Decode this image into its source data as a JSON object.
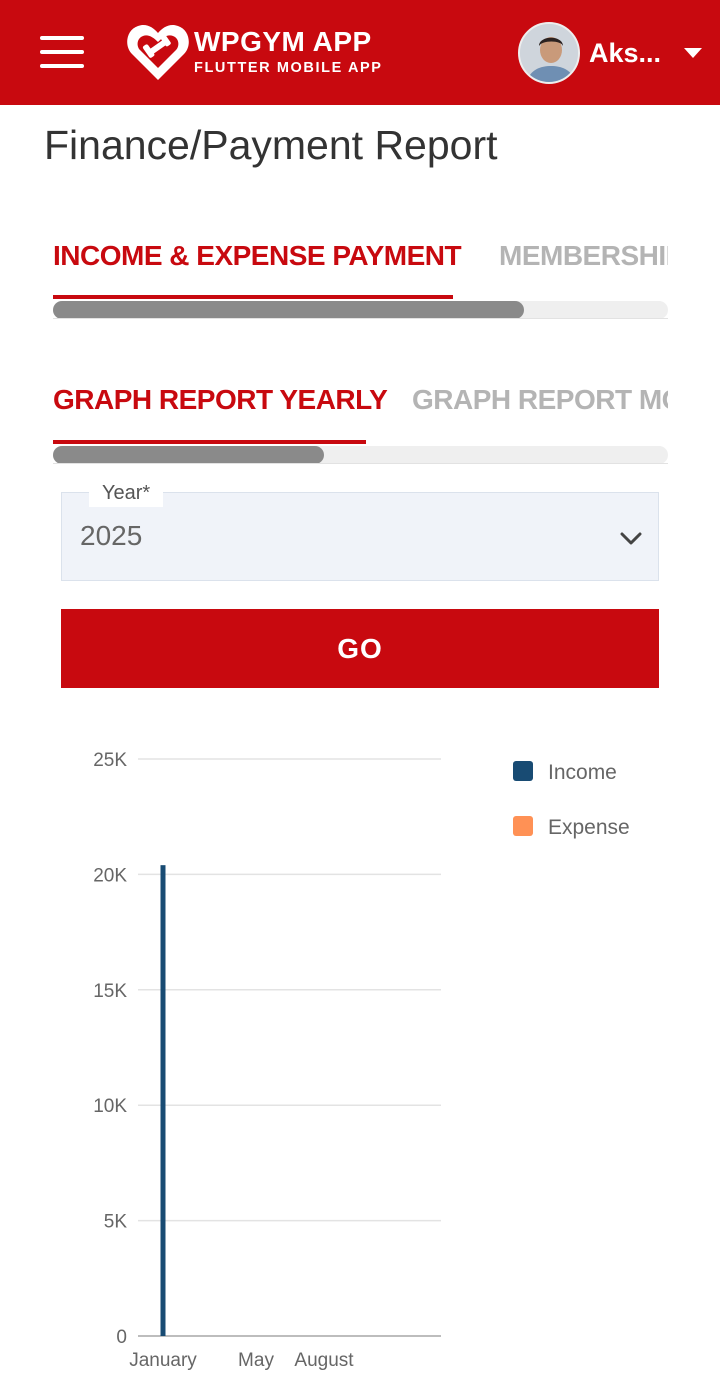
{
  "header": {
    "app_title": "WPGYM APP",
    "app_subtitle": "FLUTTER MOBILE APP",
    "user_name": "Aks...",
    "menu_icon": "hamburger-menu-icon",
    "logo_icon": "heart-dumbbell-logo-icon",
    "user_dropdown_icon": "caret-down-icon",
    "brand_color": "#c8090f"
  },
  "page": {
    "title": "Finance/Payment Report"
  },
  "tabs_primary": [
    {
      "label": "INCOME & EXPENSE PAYMENT",
      "active": true
    },
    {
      "label": "MEMBERSHIP",
      "active": false
    }
  ],
  "tabs_secondary": [
    {
      "label": "GRAPH REPORT YEARLY",
      "active": true
    },
    {
      "label": "GRAPH REPORT MONTHLY",
      "active": false
    }
  ],
  "form": {
    "year_label": "Year*",
    "year_value": "2025",
    "go_label": "GO"
  },
  "chart_data": {
    "type": "bar",
    "categories": [
      "January",
      "May",
      "August"
    ],
    "series": [
      {
        "name": "Income",
        "color": "#184b73",
        "values": [
          20400,
          0,
          0
        ]
      },
      {
        "name": "Expense",
        "color": "#ff9155",
        "values": [
          0,
          0,
          0
        ]
      }
    ],
    "y_ticks": [
      "0",
      "5K",
      "10K",
      "15K",
      "20K",
      "25K"
    ],
    "ylim": [
      0,
      25000
    ],
    "grid": true,
    "legend": "right"
  }
}
